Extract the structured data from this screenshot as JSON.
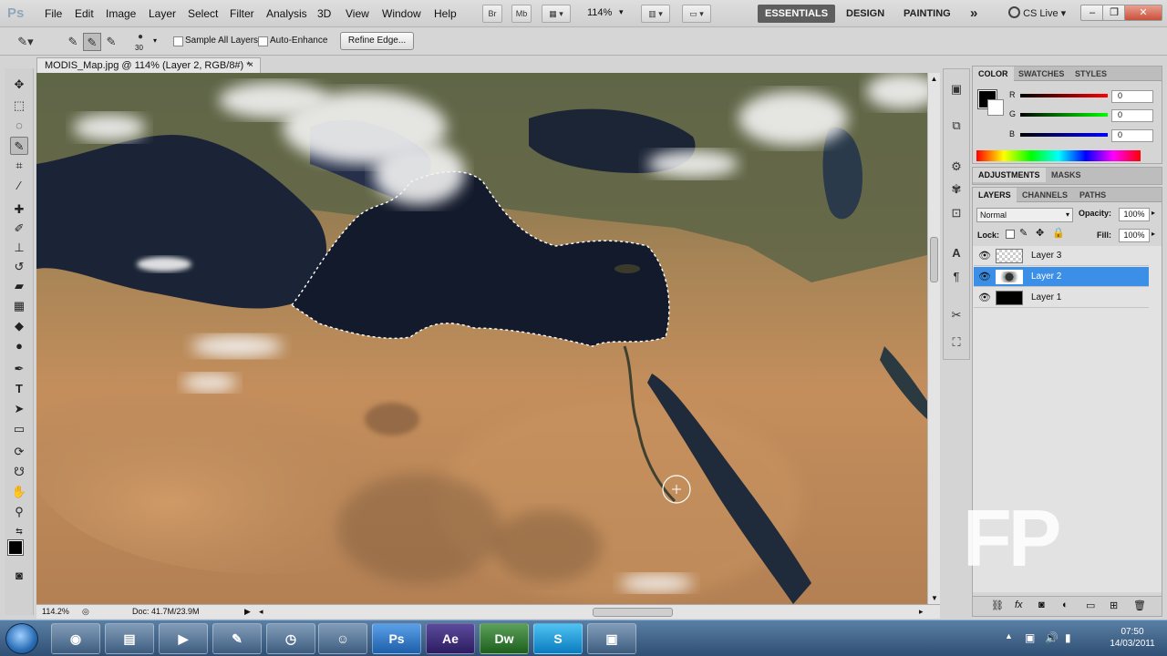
{
  "app": {
    "logo": "Ps"
  },
  "menu": [
    "File",
    "Edit",
    "Image",
    "Layer",
    "Select",
    "Filter",
    "Analysis",
    "3D",
    "View",
    "Window",
    "Help"
  ],
  "menubar_buttons": {
    "bridge": "Br",
    "minibridge": "Mb",
    "zoom": "114%"
  },
  "workspaces": [
    "ESSENTIALS",
    "DESIGN",
    "PAINTING"
  ],
  "more_workspaces": "»",
  "cs_live": "CS Live",
  "window_controls": {
    "minimize": "–",
    "restore": "❐",
    "close": "✕"
  },
  "options": {
    "brush_size": "30",
    "sample_all_layers": "Sample All Layers",
    "auto_enhance": "Auto-Enhance",
    "refine_edge": "Refine Edge..."
  },
  "document": {
    "tab_title": "MODIS_Map.jpg @ 114% (Layer 2, RGB/8#) *",
    "close": "×",
    "zoom_status": "114.2%",
    "doc_size": "Doc: 41.7M/23.9M"
  },
  "color_panel": {
    "tabs": [
      "COLOR",
      "SWATCHES",
      "STYLES"
    ],
    "channels": [
      {
        "label": "R",
        "value": "0",
        "color": "#d01010"
      },
      {
        "label": "G",
        "value": "0",
        "color": "#10a010"
      },
      {
        "label": "B",
        "value": "0",
        "color": "#1020d0"
      }
    ]
  },
  "adjust_panel": {
    "tabs": [
      "ADJUSTMENTS",
      "MASKS"
    ]
  },
  "layers_panel": {
    "tabs": [
      "LAYERS",
      "CHANNELS",
      "PATHS"
    ],
    "blend_mode": "Normal",
    "opacity_label": "Opacity:",
    "opacity": "100%",
    "lock_label": "Lock:",
    "fill_label": "Fill:",
    "fill": "100%",
    "layers": [
      {
        "name": "Layer 3",
        "selected": false
      },
      {
        "name": "Layer 2",
        "selected": true
      },
      {
        "name": "Layer 1",
        "selected": false
      }
    ]
  },
  "taskbar": {
    "apps": [
      {
        "name": "chrome",
        "label": "◉"
      },
      {
        "name": "explorer",
        "label": "▤"
      },
      {
        "name": "media-player",
        "label": "▶"
      },
      {
        "name": "pin-app",
        "label": "✎"
      },
      {
        "name": "clock-app",
        "label": "◷"
      },
      {
        "name": "messenger",
        "label": "☺"
      },
      {
        "name": "photoshop",
        "label": "Ps"
      },
      {
        "name": "after-effects",
        "label": "Ae"
      },
      {
        "name": "dreamweaver",
        "label": "Dw"
      },
      {
        "name": "skype",
        "label": "S"
      },
      {
        "name": "camtasia",
        "label": "▣"
      }
    ],
    "time": "07:50",
    "date": "14/03/2011"
  },
  "watermark": "FP"
}
